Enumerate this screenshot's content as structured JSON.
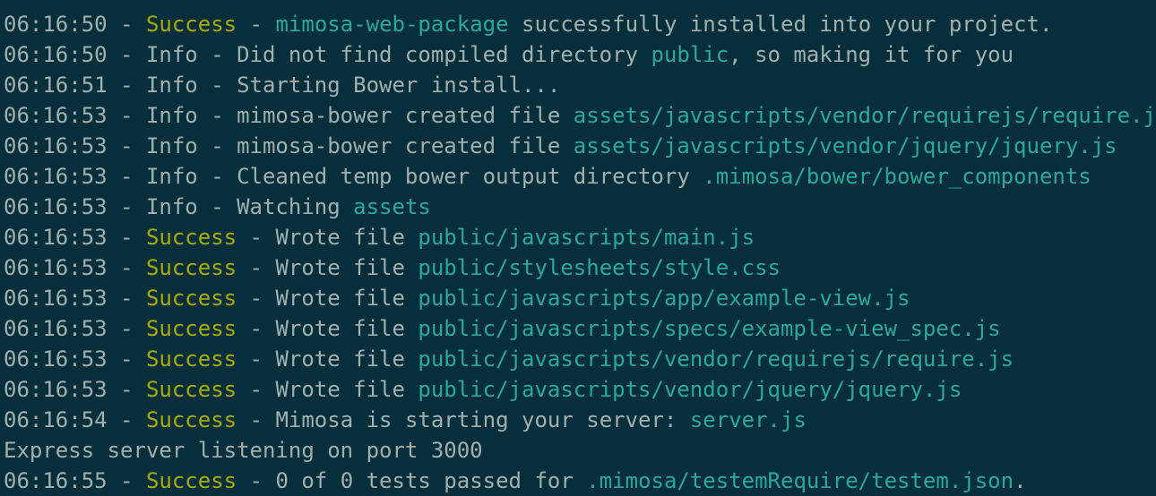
{
  "terminal": {
    "colors": {
      "background": "#062f3b",
      "text": "#9fb0ae",
      "success": "#a8aa00",
      "highlight": "#2ba79b"
    },
    "lines": [
      {
        "segments": [
          {
            "text": "06:16:50 - ",
            "style": "normal"
          },
          {
            "text": "Success",
            "style": "success"
          },
          {
            "text": " - ",
            "style": "normal"
          },
          {
            "text": "mimosa-web-package",
            "style": "highlight"
          },
          {
            "text": " successfully installed into your project.",
            "style": "normal"
          }
        ]
      },
      {
        "segments": [
          {
            "text": "06:16:50 - Info - Did not find compiled directory ",
            "style": "normal"
          },
          {
            "text": "public",
            "style": "highlight"
          },
          {
            "text": ", so making it for you",
            "style": "normal"
          }
        ]
      },
      {
        "segments": [
          {
            "text": "06:16:51 - Info - Starting Bower install...",
            "style": "normal"
          }
        ]
      },
      {
        "segments": [
          {
            "text": "06:16:53 - Info - mimosa-bower created file ",
            "style": "normal"
          },
          {
            "text": "assets/javascripts/vendor/requirejs/require.js",
            "style": "highlight"
          }
        ]
      },
      {
        "segments": [
          {
            "text": "06:16:53 - Info - mimosa-bower created file ",
            "style": "normal"
          },
          {
            "text": "assets/javascripts/vendor/jquery/jquery.js",
            "style": "highlight"
          }
        ]
      },
      {
        "segments": [
          {
            "text": "06:16:53 - Info - Cleaned temp bower output directory ",
            "style": "normal"
          },
          {
            "text": ".mimosa/bower/bower_components",
            "style": "highlight"
          }
        ]
      },
      {
        "segments": [
          {
            "text": "06:16:53 - Info - Watching ",
            "style": "normal"
          },
          {
            "text": "assets",
            "style": "highlight"
          }
        ]
      },
      {
        "segments": [
          {
            "text": "06:16:53 - ",
            "style": "normal"
          },
          {
            "text": "Success",
            "style": "success"
          },
          {
            "text": " - Wrote file ",
            "style": "normal"
          },
          {
            "text": "public/javascripts/main.js",
            "style": "highlight"
          }
        ]
      },
      {
        "segments": [
          {
            "text": "06:16:53 - ",
            "style": "normal"
          },
          {
            "text": "Success",
            "style": "success"
          },
          {
            "text": " - Wrote file ",
            "style": "normal"
          },
          {
            "text": "public/stylesheets/style.css",
            "style": "highlight"
          }
        ]
      },
      {
        "segments": [
          {
            "text": "06:16:53 - ",
            "style": "normal"
          },
          {
            "text": "Success",
            "style": "success"
          },
          {
            "text": " - Wrote file ",
            "style": "normal"
          },
          {
            "text": "public/javascripts/app/example-view.js",
            "style": "highlight"
          }
        ]
      },
      {
        "segments": [
          {
            "text": "06:16:53 - ",
            "style": "normal"
          },
          {
            "text": "Success",
            "style": "success"
          },
          {
            "text": " - Wrote file ",
            "style": "normal"
          },
          {
            "text": "public/javascripts/specs/example-view_spec.js",
            "style": "highlight"
          }
        ]
      },
      {
        "segments": [
          {
            "text": "06:16:53 - ",
            "style": "normal"
          },
          {
            "text": "Success",
            "style": "success"
          },
          {
            "text": " - Wrote file ",
            "style": "normal"
          },
          {
            "text": "public/javascripts/vendor/requirejs/require.js",
            "style": "highlight"
          }
        ]
      },
      {
        "segments": [
          {
            "text": "06:16:53 - ",
            "style": "normal"
          },
          {
            "text": "Success",
            "style": "success"
          },
          {
            "text": " - Wrote file ",
            "style": "normal"
          },
          {
            "text": "public/javascripts/vendor/jquery/jquery.js",
            "style": "highlight"
          }
        ]
      },
      {
        "segments": [
          {
            "text": "06:16:54 - ",
            "style": "normal"
          },
          {
            "text": "Success",
            "style": "success"
          },
          {
            "text": " - Mimosa is starting your server: ",
            "style": "normal"
          },
          {
            "text": "server.js",
            "style": "highlight"
          }
        ]
      },
      {
        "segments": [
          {
            "text": "Express server listening on port 3000",
            "style": "normal"
          }
        ]
      },
      {
        "segments": [
          {
            "text": "06:16:55 - ",
            "style": "normal"
          },
          {
            "text": "Success",
            "style": "success"
          },
          {
            "text": " - 0 of 0 tests passed for ",
            "style": "normal"
          },
          {
            "text": ".mimosa/testemRequire/testem.json",
            "style": "highlight"
          },
          {
            "text": ".",
            "style": "normal"
          }
        ]
      }
    ]
  }
}
